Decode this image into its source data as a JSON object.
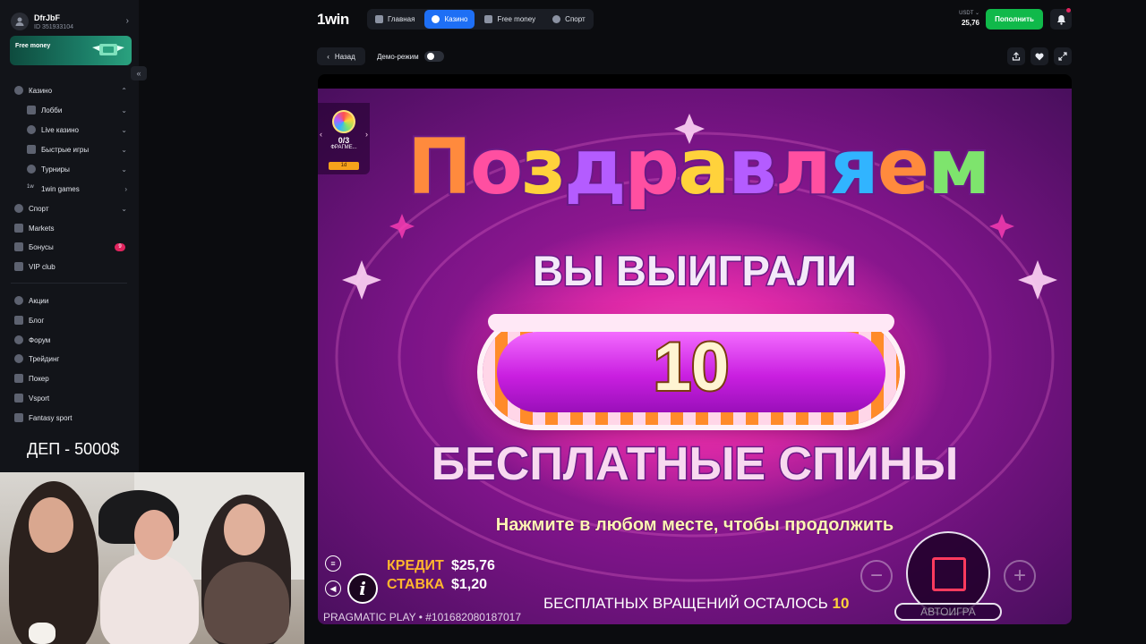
{
  "user": {
    "name": "DfrJbF",
    "id": "ID 351933104"
  },
  "promo": {
    "label": "Free money"
  },
  "sidebar": {
    "items": [
      {
        "label": "Казино",
        "chev": "⌃"
      },
      {
        "label": "Лобби",
        "chev": "⌄"
      },
      {
        "label": "Live казино",
        "chev": "⌄"
      },
      {
        "label": "Быстрые игры",
        "chev": "⌄"
      },
      {
        "label": "Турниры",
        "chev": "⌄"
      },
      {
        "label": "1win games",
        "chev": "›"
      },
      {
        "label": "Спорт",
        "chev": "⌄"
      },
      {
        "label": "Markets"
      },
      {
        "label": "Бонусы",
        "badge": "9"
      },
      {
        "label": "VIP club"
      },
      {
        "label": "Акции"
      },
      {
        "label": "Блог"
      },
      {
        "label": "Форум"
      },
      {
        "label": "Трейдинг"
      },
      {
        "label": "Покер"
      },
      {
        "label": "Vsport"
      },
      {
        "label": "Fantasy sport"
      }
    ]
  },
  "overlay_text": "ДЕП - 5000$",
  "header": {
    "logo": "1win",
    "nav": [
      "Главная",
      "Казино",
      "Free money",
      "Спорт"
    ],
    "balance_currency": "USDT ⌄",
    "balance_value": "25,76",
    "deposit_label": "Пополнить"
  },
  "toolbar": {
    "back_label": "Назад",
    "demo_label": "Демо-режим"
  },
  "game": {
    "congrats": "Поздравляем",
    "won": "ВЫ ВЫИГРАЛИ",
    "amount": "10",
    "free_spins": "БЕСПЛАТНЫЕ СПИНЫ",
    "tap_hint": "Нажмите в любом месте, чтобы продолжить",
    "fragments_count": "0/3",
    "fragments_label": "ФРАГМЕ...",
    "fragments_tag": "1d",
    "credit_label": "КРЕДИТ",
    "credit_value": "$25,76",
    "bet_label": "СТАВКА",
    "bet_value": "$1,20",
    "provider": "PRAGMATIC PLAY • #101682080187017",
    "spins_left_label": "БЕСПЛАТНЫХ ВРАЩЕНИЙ ОСТАЛОСЬ",
    "spins_left_value": "10",
    "autoplay_label": "АВТОИГРА"
  },
  "colors": {
    "accent": "#1e6ff5",
    "deposit": "#10b94a",
    "badge": "#e0245e"
  }
}
